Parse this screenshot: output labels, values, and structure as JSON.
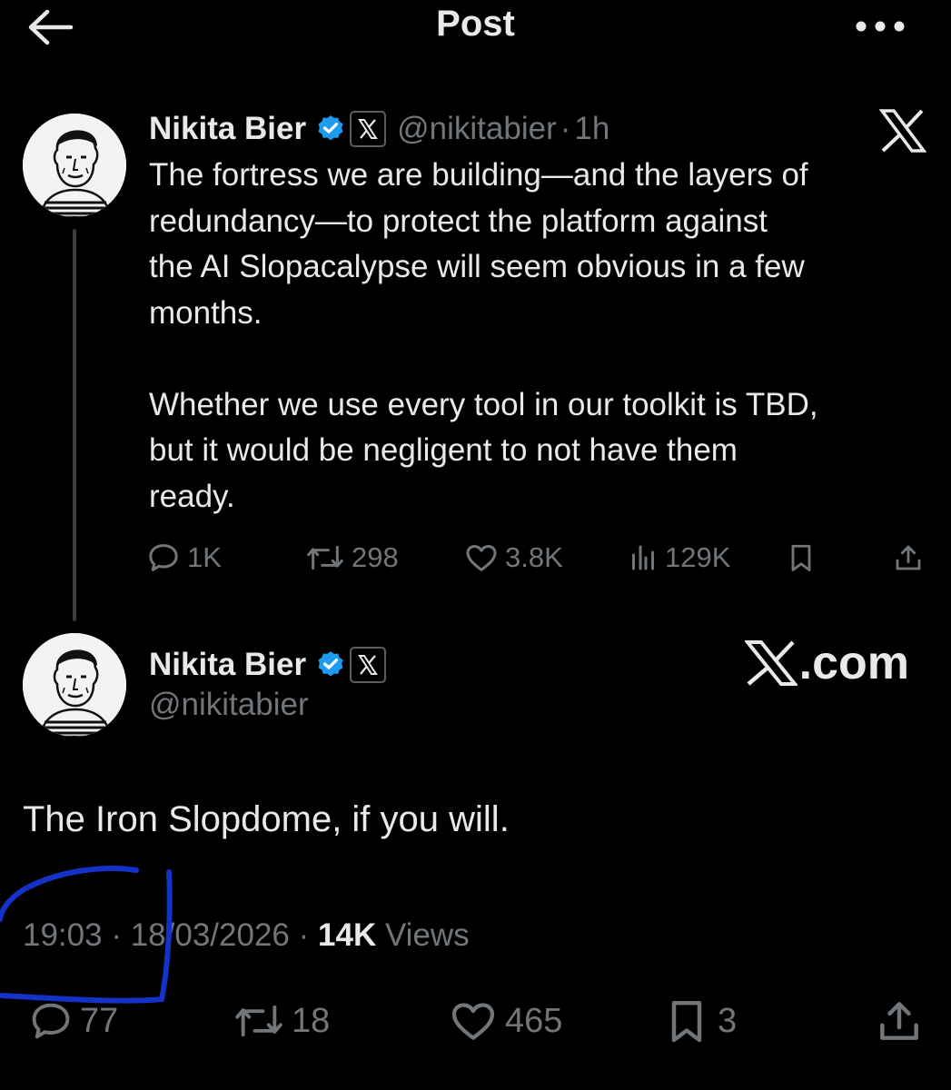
{
  "header": {
    "title": "Post"
  },
  "parent_tweet": {
    "display_name": "Nikita Bier",
    "handle": "@nikitabier",
    "separator": "·",
    "time_ago": "1h",
    "text": "The fortress we are building—and the layers of\nredundancy—to protect the platform against\nthe AI Slopacalypse will seem obvious in a few\nmonths.\n\nWhether we use every tool in our toolkit is TBD,\nbut it would be negligent to not have them\nready.",
    "actions": {
      "replies": "1K",
      "reposts": "298",
      "likes": "3.8K",
      "views": "129K"
    }
  },
  "main_tweet": {
    "display_name": "Nikita Bier",
    "handle": "@nikitabier",
    "watermark": ".com",
    "text": "The Iron Slopdome, if you will.",
    "time": "19:03",
    "date": "18/03/2026",
    "separator": "·",
    "views_count": "14K",
    "views_label": "Views",
    "actions": {
      "replies": "77",
      "reposts": "18",
      "likes": "465",
      "bookmarks": "3"
    }
  },
  "colors": {
    "background": "#000000",
    "text": "#e7e9ea",
    "muted": "#71767b",
    "verified": "#1d9bf0",
    "annotation": "#1432c8"
  }
}
